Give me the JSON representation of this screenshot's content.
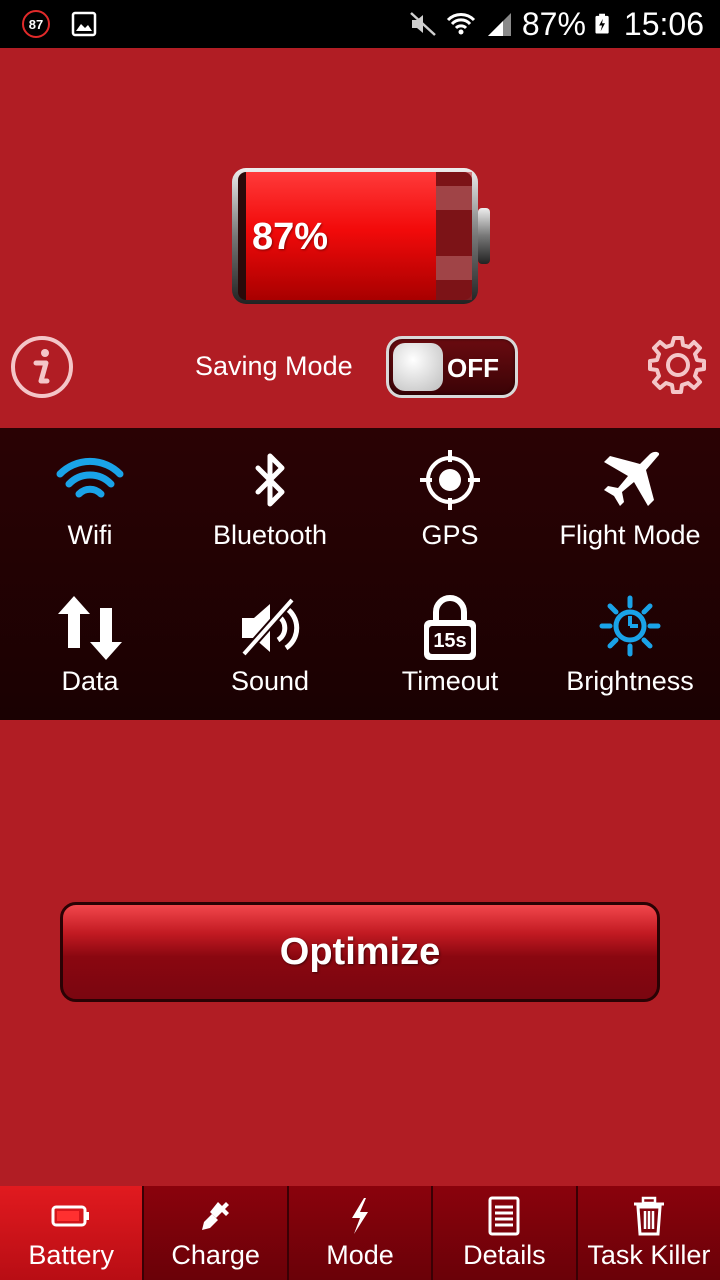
{
  "status_bar": {
    "notification_badge": "87",
    "battery_percent": "87%",
    "time": "15:06"
  },
  "battery": {
    "level_text": "87%",
    "level_fraction": 0.87
  },
  "saving_mode": {
    "label": "Saving Mode",
    "toggle_state": "OFF"
  },
  "quick_toggles": [
    {
      "label": "Wifi",
      "icon": "wifi-icon"
    },
    {
      "label": "Bluetooth",
      "icon": "bluetooth-icon"
    },
    {
      "label": "GPS",
      "icon": "gps-icon"
    },
    {
      "label": "Flight Mode",
      "icon": "airplane-icon"
    },
    {
      "label": "Data",
      "icon": "data-arrows-icon"
    },
    {
      "label": "Sound",
      "icon": "speaker-icon"
    },
    {
      "label": "Timeout",
      "icon": "lock-timer-icon",
      "badge": "15s"
    },
    {
      "label": "Brightness",
      "icon": "sun-icon"
    }
  ],
  "optimize_button": "Optimize",
  "bottom_nav": [
    {
      "label": "Battery",
      "icon": "battery-icon",
      "active": true
    },
    {
      "label": "Charge",
      "icon": "plug-icon"
    },
    {
      "label": "Mode",
      "icon": "lightning-icon"
    },
    {
      "label": "Details",
      "icon": "document-icon"
    },
    {
      "label": "Task Killer",
      "icon": "trash-icon"
    }
  ],
  "colors": {
    "background": "#b11d24",
    "panel": "#1f0103",
    "accent_blue": "#1aa3e8"
  }
}
